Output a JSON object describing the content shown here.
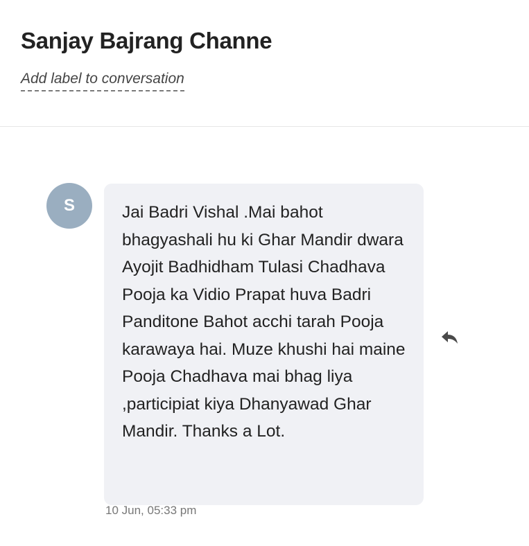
{
  "conversation": {
    "contact_name": "Sanjay Bajrang Channe",
    "label_link": "Add label to conversation"
  },
  "message": {
    "avatar_initial": "S",
    "text": "Jai Badri Vishal .Mai bahot bhagyashali hu ki Ghar Mandir dwara Ayojit Badhidham Tulasi Chadhava Pooja ka Vidio Prapat huva Badri Panditone Bahot acchi tarah Pooja karawaya hai. Muze khushi hai maine Pooja Chadhava mai bhag liya ,participiat kiya Dhanyawad Ghar Mandir. Thanks a Lot.",
    "timestamp": "10 Jun, 05:33 pm",
    "reply_icon": "reply-icon"
  },
  "colors": {
    "avatar_bg": "#9aaec0",
    "bubble_bg": "#f0f1f5"
  }
}
